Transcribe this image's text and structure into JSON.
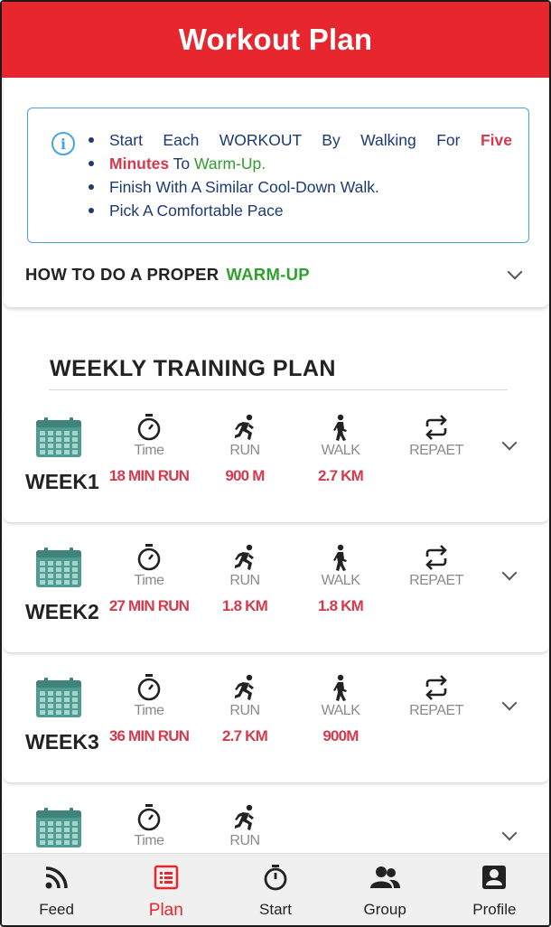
{
  "header": {
    "title": "Workout Plan"
  },
  "info": {
    "line1_a": "Start Each WORKOUT By Walking For",
    "line1_red": "Five",
    "line2_red": "Minutes",
    "line2_mid": "To",
    "line2_green": "Warm-Up.",
    "line3": "Finish With A Similar Cool-Down Walk.",
    "line4": "Pick A Comfortable Pace"
  },
  "warmup": {
    "label": "HOW TO DO A PROPER",
    "highlight": "WARM-UP"
  },
  "section": {
    "title": "WEEKLY TRAINING PLAN"
  },
  "stat_labels": {
    "time": "Time",
    "run": "RUN",
    "walk": "WALK",
    "repeat": "REPAET"
  },
  "weeks": [
    {
      "label": "WEEK1",
      "time": "18 MIN RUN",
      "run": "900 M",
      "walk": "2.7 KM",
      "repeat": ""
    },
    {
      "label": "WEEK2",
      "time": "27 MIN RUN",
      "run": "1.8 KM",
      "walk": "1.8 KM",
      "repeat": ""
    },
    {
      "label": "WEEK3",
      "time": "36 MIN RUN",
      "run": "2.7 KM",
      "walk": "900M",
      "repeat": ""
    },
    {
      "label": "",
      "time": "",
      "run": "",
      "walk": "",
      "repeat": ""
    }
  ],
  "nav": {
    "feed": "Feed",
    "plan": "Plan",
    "start": "Start",
    "group": "Group",
    "profile": "Profile"
  },
  "colors": {
    "brand_red": "#e8262d",
    "value_red": "#d43a4e",
    "accent_green": "#2ea12e",
    "info_blue": "#4aa3df",
    "calendar_teal": "#4e9c92"
  }
}
